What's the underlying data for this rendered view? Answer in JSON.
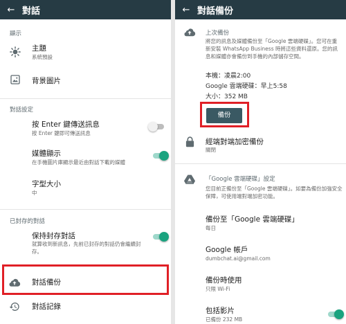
{
  "left": {
    "header": {
      "title": "對話"
    },
    "display_section": "顯示",
    "theme": {
      "title": "主題",
      "sub": "系統預設"
    },
    "wallpaper": {
      "title": "背景圖片"
    },
    "chat_settings_section": "對話設定",
    "enter_send": {
      "title": "按 Enter 鍵傳送訊息",
      "sub": "按 Enter 鍵即可傳送訊息",
      "on": false
    },
    "media_visibility": {
      "title": "媒體顯示",
      "sub": "在手機圖片庫顯示最近由對話下載的媒體",
      "on": true
    },
    "font_size": {
      "title": "字型大小",
      "sub": "中"
    },
    "archived_section": "已封存的對話",
    "keep_archived": {
      "title": "保持封存對話",
      "sub": "就算收到新訊息，先前已封存的對話仍會繼續封存。",
      "on": true
    },
    "chat_backup": {
      "title": "對話備份"
    },
    "chat_history": {
      "title": "對話記錄"
    }
  },
  "right": {
    "header": {
      "title": "對話備份"
    },
    "last_backup": {
      "title": "上次備份",
      "desc": "將您的訊息及媒體備份至「Google 雲端硬碟」。您可在重新安裝 WhatsApp Business 時將這些資料還原。您的訊息和媒體亦會備份到手機的內部儲存空間。",
      "local": "本機：凌晨2:00",
      "gdrive": "Google 雲端硬碟：早上5:58",
      "size": "大小：352 MB",
      "button": "備份"
    },
    "e2e": {
      "title": "經端對端加密備份",
      "sub": "關閉"
    },
    "gdrive_settings": {
      "title": "「Google 雲端硬碟」設定",
      "desc": "您目前正備份至「Google 雲端硬碟」。如要為備份加強安全保障，可使用端對端加密功能。"
    },
    "backup_to": {
      "title": "備份至「Google 雲端硬碟」",
      "sub": "每日"
    },
    "account": {
      "title": "Google 帳戶",
      "sub": "dumbchat.ai@gmail.com"
    },
    "backup_using": {
      "title": "備份時使用",
      "sub": "只限 Wi-Fi"
    },
    "include_videos": {
      "title": "包括影片",
      "sub": "已備份 232 MB",
      "on": true
    }
  },
  "colors": {
    "appbar": "#263b44",
    "accent": "#1aa37f",
    "highlight": "#e01f26",
    "button": "#3a5963"
  }
}
